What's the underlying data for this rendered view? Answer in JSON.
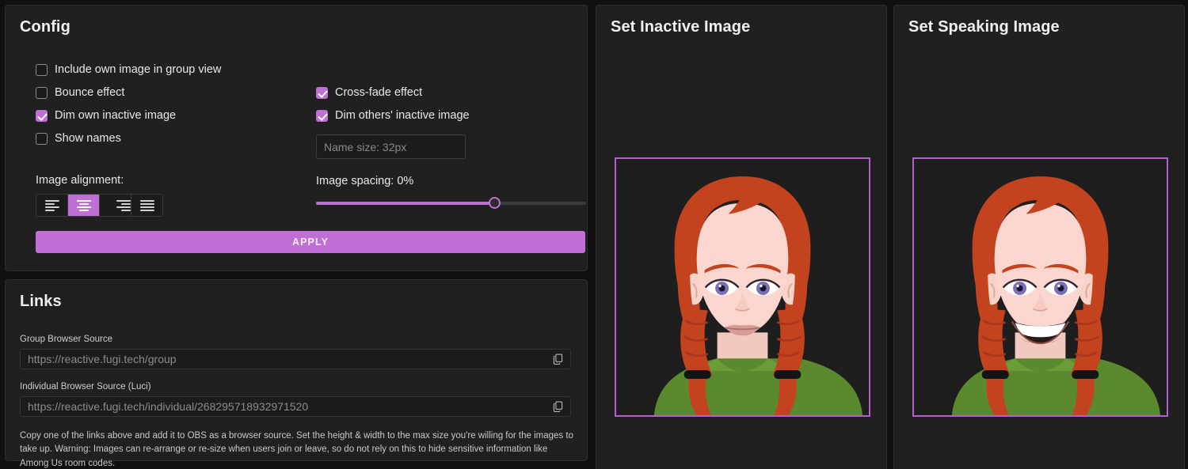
{
  "theme": {
    "page_bg": "#101010",
    "panel_bg": "#202020",
    "accent": "#c06fd4",
    "frame_border": "#b85fd0",
    "text": "#ece7ec",
    "muted_text": "#8e8a8e"
  },
  "config": {
    "title": "Config",
    "checkboxes_left": [
      {
        "label": "Include own image in group view",
        "checked": false
      },
      {
        "label": "Bounce effect",
        "checked": false
      },
      {
        "label": "Dim own inactive image",
        "checked": true
      },
      {
        "label": "Show names",
        "checked": false
      }
    ],
    "checkboxes_right": [
      {
        "label": "Cross-fade effect",
        "checked": true
      },
      {
        "label": "Dim others' inactive image",
        "checked": true
      }
    ],
    "name_size": {
      "placeholder": "Name size: 32px",
      "value": "",
      "stepper_up": "chevron-up-icon",
      "stepper_down": "chevron-down-icon"
    },
    "image_spacing": {
      "label": "Image spacing: 0%",
      "value_percent": 0,
      "thumb_position_percent": 66
    },
    "alignment": {
      "label": "Image alignment:",
      "options": [
        {
          "name": "align-left",
          "selected": false
        },
        {
          "name": "align-center",
          "selected": true
        },
        {
          "name": "align-right",
          "selected": false
        },
        {
          "name": "align-justify",
          "selected": false
        }
      ]
    },
    "apply_label": "APPLY"
  },
  "links": {
    "title": "Links",
    "group": {
      "label": "Group Browser Source",
      "url": "https://reactive.fugi.tech/group",
      "copy_icon": "copy-icon"
    },
    "individual": {
      "label": "Individual Browser Source (Luci)",
      "url": "https://reactive.fugi.tech/individual/268295718932971520",
      "copy_icon": "copy-icon"
    },
    "warning": "Copy one of the links above and add it to OBS as a browser source. Set the height & width to the max size you're willing for the images to take up. Warning: Images can re-arrange or re-size when users join or leave, so do not rely on this to hide sensitive information like Among Us room codes."
  },
  "inactive_image": {
    "title": "Set Inactive Image",
    "avatar": "avatar-woman-red-braids-neutral"
  },
  "speaking_image": {
    "title": "Set Speaking Image",
    "avatar": "avatar-woman-red-braids-smiling"
  }
}
